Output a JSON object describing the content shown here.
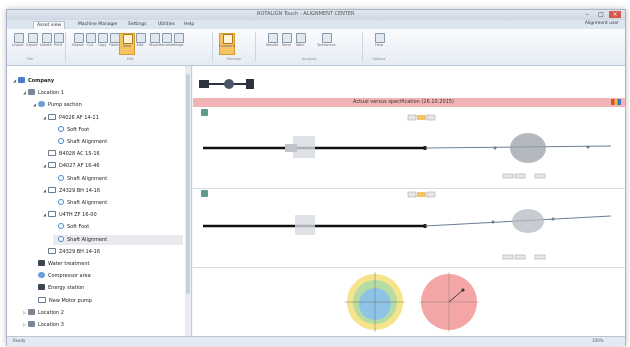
{
  "app": {
    "title": "ROTALIGN Touch - ALIGNMENT CENTER",
    "window_controls": {
      "minimize": "–",
      "maximize": "□",
      "close": "×"
    },
    "user_label": "Alignment user"
  },
  "tabs": [
    {
      "label": "Asset view",
      "active": true
    },
    {
      "label": "Machine Manager",
      "active": false
    },
    {
      "label": "Settings",
      "active": false
    },
    {
      "label": "Utilities",
      "active": false
    },
    {
      "label": "Help",
      "active": false
    }
  ],
  "ribbon": {
    "buttons": [
      {
        "label": "Import",
        "highlight": false
      },
      {
        "label": "Export",
        "highlight": false
      },
      {
        "label": "Delete",
        "highlight": false
      },
      {
        "label": "Print",
        "highlight": false
      },
      {
        "label": "Report",
        "highlight": false
      },
      {
        "label": "Cut",
        "highlight": false
      },
      {
        "label": "Copy",
        "highlight": false
      },
      {
        "label": "Paste",
        "highlight": false
      },
      {
        "label": "New",
        "highlight": true
      },
      {
        "label": "Edit",
        "highlight": false
      },
      {
        "label": "Move",
        "highlight": false
      },
      {
        "label": "Rename",
        "highlight": false
      },
      {
        "label": "Merge",
        "highlight": false
      },
      {
        "label": "Compare",
        "highlight": true
      },
      {
        "label": "Results",
        "highlight": false
      },
      {
        "label": "Trend",
        "highlight": false
      },
      {
        "label": "Table",
        "highlight": false
      },
      {
        "label": "Tolerances",
        "highlight": false
      },
      {
        "label": "Help",
        "highlight": false
      }
    ],
    "groups": [
      "File",
      "Edit",
      "Manage",
      "Analysis",
      "Options"
    ]
  },
  "tree": {
    "items": [
      {
        "label": "Company",
        "level": 0,
        "icon": "company-icon",
        "expanded": true
      },
      {
        "label": "Location 1",
        "level": 1,
        "icon": "location-icon",
        "expanded": true
      },
      {
        "label": "Pump section",
        "level": 2,
        "icon": "pump-icon",
        "expanded": true
      },
      {
        "label": "P4026 AF 14-11",
        "level": 3,
        "icon": "machine-train-icon",
        "expanded": true
      },
      {
        "label": "Soft Foot",
        "level": 4,
        "icon": "measurement-icon"
      },
      {
        "label": "Shaft Alignment",
        "level": 4,
        "icon": "measurement-icon"
      },
      {
        "label": "B4028 AC 15-16",
        "level": 3,
        "icon": "machine-train-icon"
      },
      {
        "label": "D4027 AF 16-46",
        "level": 3,
        "icon": "machine-train-icon",
        "expanded": true
      },
      {
        "label": "Shaft Alignment",
        "level": 4,
        "icon": "measurement-icon"
      },
      {
        "label": "Z4329 BH 14-16",
        "level": 3,
        "icon": "machine-train-icon",
        "expanded": true
      },
      {
        "label": "Shaft Alignment",
        "level": 4,
        "icon": "measurement-icon"
      },
      {
        "label": "U4TH ZF 16-00",
        "level": 3,
        "icon": "machine-train-icon",
        "expanded": true
      },
      {
        "label": "Soft Foot",
        "level": 4,
        "icon": "measurement-icon"
      },
      {
        "label": "Shaft Alignment",
        "level": 4,
        "icon": "measurement-icon",
        "selected": true
      },
      {
        "label": "Z4329 BH 14-16",
        "level": 3,
        "icon": "machine-train-icon"
      },
      {
        "label": "Water treatment",
        "level": 2,
        "icon": "block-icon"
      },
      {
        "label": "Compressor area",
        "level": 2,
        "icon": "pump-icon"
      },
      {
        "label": "Energy station",
        "level": 2,
        "icon": "block-icon"
      },
      {
        "label": "New Motor pump",
        "level": 2,
        "icon": "machine-train-icon"
      },
      {
        "label": "Location 2",
        "level": 1,
        "icon": "location-icon",
        "expanded": false
      },
      {
        "label": "Location 3",
        "level": 1,
        "icon": "location-icon",
        "expanded": false
      }
    ]
  },
  "main": {
    "banner": "Actual versus specification (26.10.2015)",
    "colors": {
      "banner_bg": "#f2b3b6",
      "selection": "#e8eaee",
      "accent": "#f5c361",
      "shaft": "#111111",
      "target_inner_green": "#b7dca3",
      "target_inner_blue": "#8fc3e6",
      "target_outer_yellow": "#f5e48c",
      "target_red": "#f4a6a6"
    }
  },
  "status": {
    "left": "Ready",
    "right": "100%"
  }
}
